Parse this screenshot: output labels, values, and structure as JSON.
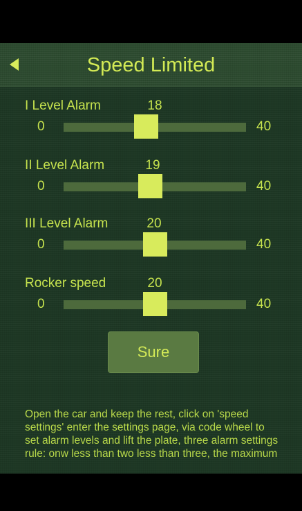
{
  "header": {
    "title": "Speed Limited",
    "back_icon": "back-arrow-icon"
  },
  "sliders": [
    {
      "label": "I Level Alarm",
      "value": 18,
      "min": 0,
      "max": 40,
      "min_label": "0",
      "max_label": "40",
      "value_label": "18"
    },
    {
      "label": "II Level Alarm",
      "value": 19,
      "min": 0,
      "max": 40,
      "min_label": "0",
      "max_label": "40",
      "value_label": "19"
    },
    {
      "label": "III Level Alarm",
      "value": 20,
      "min": 0,
      "max": 40,
      "min_label": "0",
      "max_label": "40",
      "value_label": "20"
    },
    {
      "label": "Rocker speed",
      "value": 20,
      "min": 0,
      "max": 40,
      "min_label": "0",
      "max_label": "40",
      "value_label": "20"
    }
  ],
  "sure_button": {
    "label": "Sure"
  },
  "help_text": "Open the car and keep the rest, click on 'speed settings' enter the settings page, via code wheel to set alarm levels and lift the plate, three alarm settings rule: onw less than two less than three, the maximum",
  "colors": {
    "accent": "#d8eb5c",
    "background": "#1d3724",
    "track": "#4d6a3c",
    "text": "#c6e34e"
  }
}
